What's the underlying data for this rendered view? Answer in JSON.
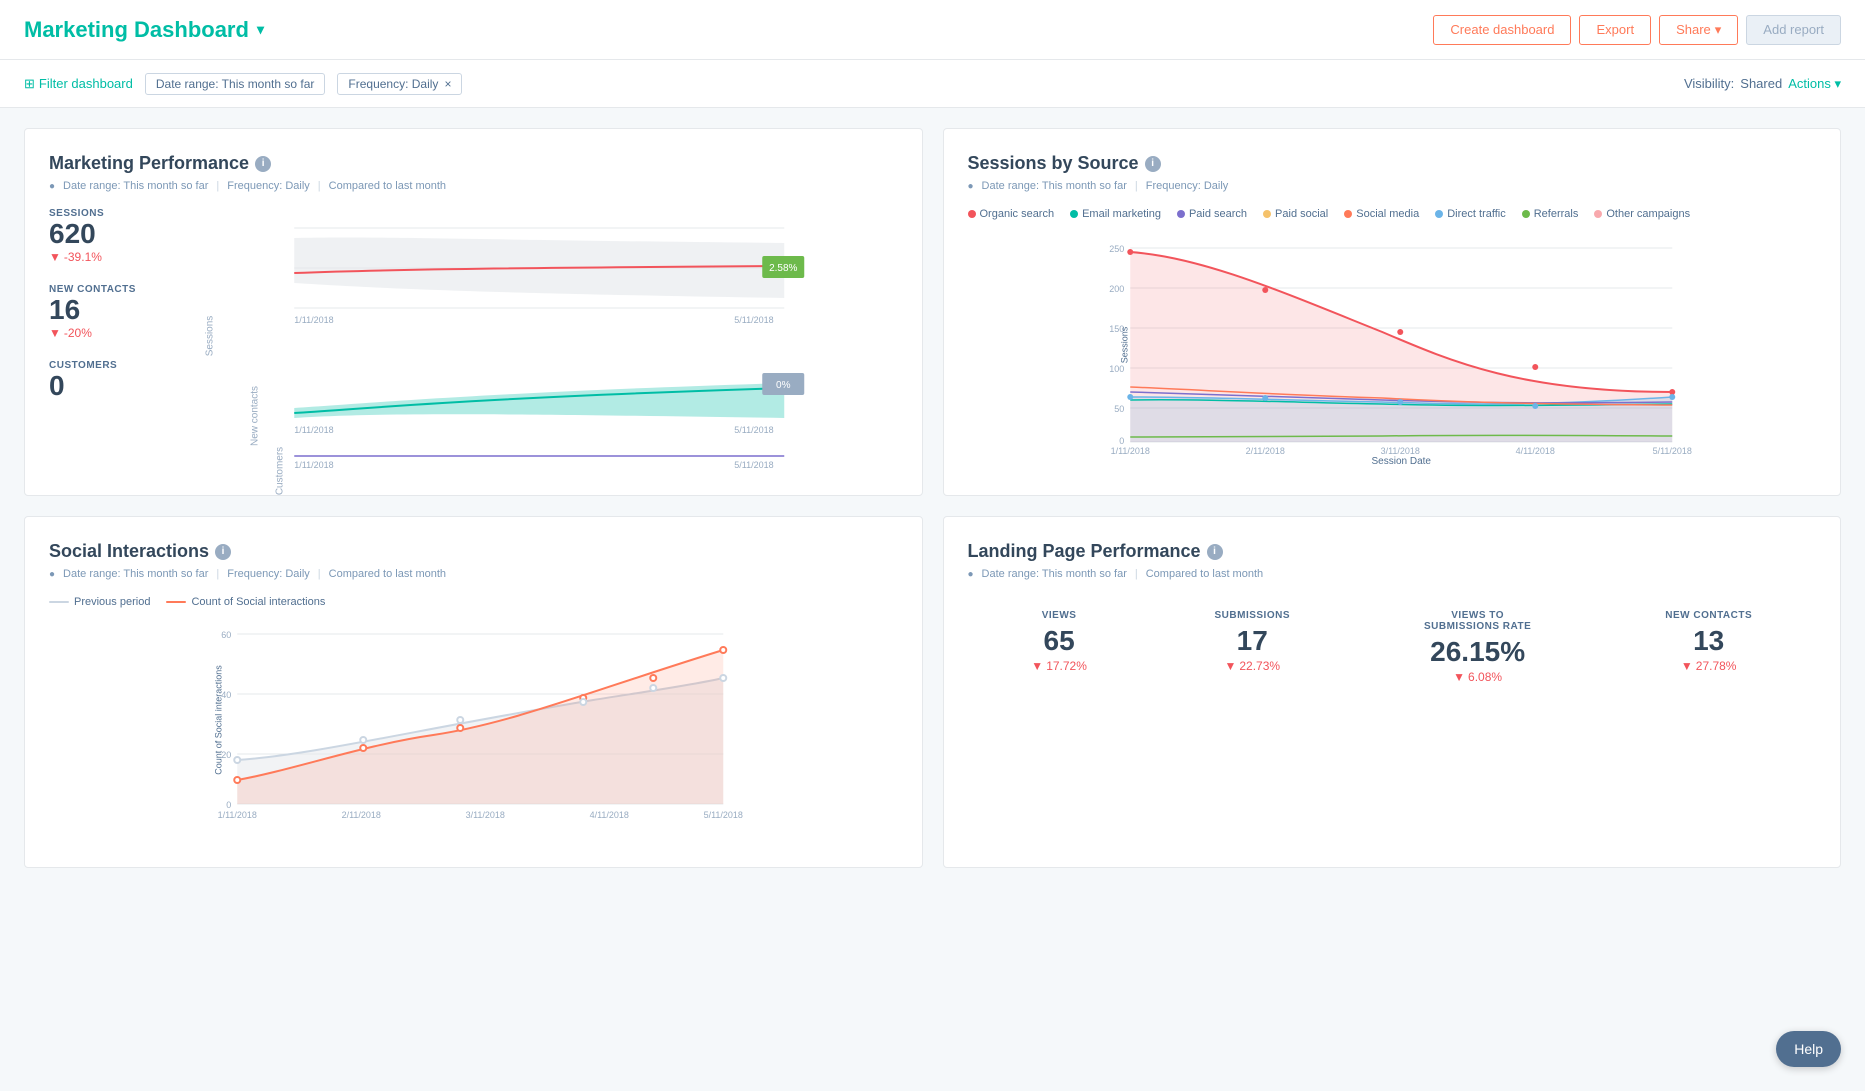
{
  "header": {
    "title": "Marketing Dashboard",
    "buttons": {
      "create": "Create dashboard",
      "export": "Export",
      "share": "Share",
      "add_report": "Add report"
    }
  },
  "filter_bar": {
    "filter_label": "Filter dashboard",
    "date_tag": "Date range: This month so far",
    "freq_tag": "Frequency: Daily",
    "visibility_label": "Visibility:",
    "visibility_value": "Shared",
    "actions_label": "Actions"
  },
  "marketing_performance": {
    "title": "Marketing Performance",
    "meta_date": "Date range: This month so far",
    "meta_freq": "Frequency: Daily",
    "meta_compare": "Compared to last month",
    "sessions_label": "SESSIONS",
    "sessions_value": "620",
    "sessions_change": "-39.1%",
    "new_contacts_label": "NEW CONTACTS",
    "new_contacts_value": "16",
    "new_contacts_change": "-20%",
    "customers_label": "CUSTOMERS",
    "customers_value": "0",
    "badge_sessions": "2.58%",
    "badge_contacts": "0%",
    "date_start": "1/11/2018",
    "date_end": "5/11/2018"
  },
  "sessions_by_source": {
    "title": "Sessions by Source",
    "meta_date": "Date range: This month so far",
    "meta_freq": "Frequency: Daily",
    "legend": [
      {
        "label": "Organic search",
        "color": "#f2545b"
      },
      {
        "label": "Email marketing",
        "color": "#00bda5"
      },
      {
        "label": "Paid search",
        "color": "#7c6fcd"
      },
      {
        "label": "Paid social",
        "color": "#f5c26b"
      },
      {
        "label": "Social media",
        "color": "#ff7a59"
      },
      {
        "label": "Direct traffic",
        "color": "#6bb4e8"
      },
      {
        "label": "Referrals",
        "color": "#6dba4b"
      },
      {
        "label": "Other campaigns",
        "color": "#f2545b"
      }
    ],
    "x_labels": [
      "1/11/2018",
      "2/11/2018",
      "3/11/2018",
      "4/11/2018",
      "5/11/2018"
    ],
    "y_labels": [
      "0",
      "50",
      "100",
      "150",
      "200",
      "250"
    ],
    "x_axis_title": "Session Date"
  },
  "social_interactions": {
    "title": "Social Interactions",
    "meta_date": "Date range: This month so far",
    "meta_freq": "Frequency: Daily",
    "meta_compare": "Compared to last month",
    "legend_prev": "Previous period",
    "legend_count": "Count of Social interactions",
    "x_labels": [
      "1/11/2018",
      "2/11/2018",
      "3/11/2018",
      "4/11/2018",
      "5/11/2018"
    ],
    "y_labels": [
      "0",
      "20",
      "40",
      "60"
    ]
  },
  "landing_page": {
    "title": "Landing Page Performance",
    "meta_date": "Date range: This month so far",
    "meta_compare": "Compared to last month",
    "metrics": [
      {
        "label": "VIEWS",
        "value": "65",
        "change": "▼ 17.72%"
      },
      {
        "label": "SUBMISSIONS",
        "value": "17",
        "change": "▼ 22.73%"
      },
      {
        "label": "VIEWS TO SUBMISSIONS RATE",
        "value": "26.15%",
        "change": "▼ 6.08%"
      },
      {
        "label": "NEW CONTACTS",
        "value": "13",
        "change": "▼ 27.78%"
      }
    ]
  },
  "help_button": "Help"
}
